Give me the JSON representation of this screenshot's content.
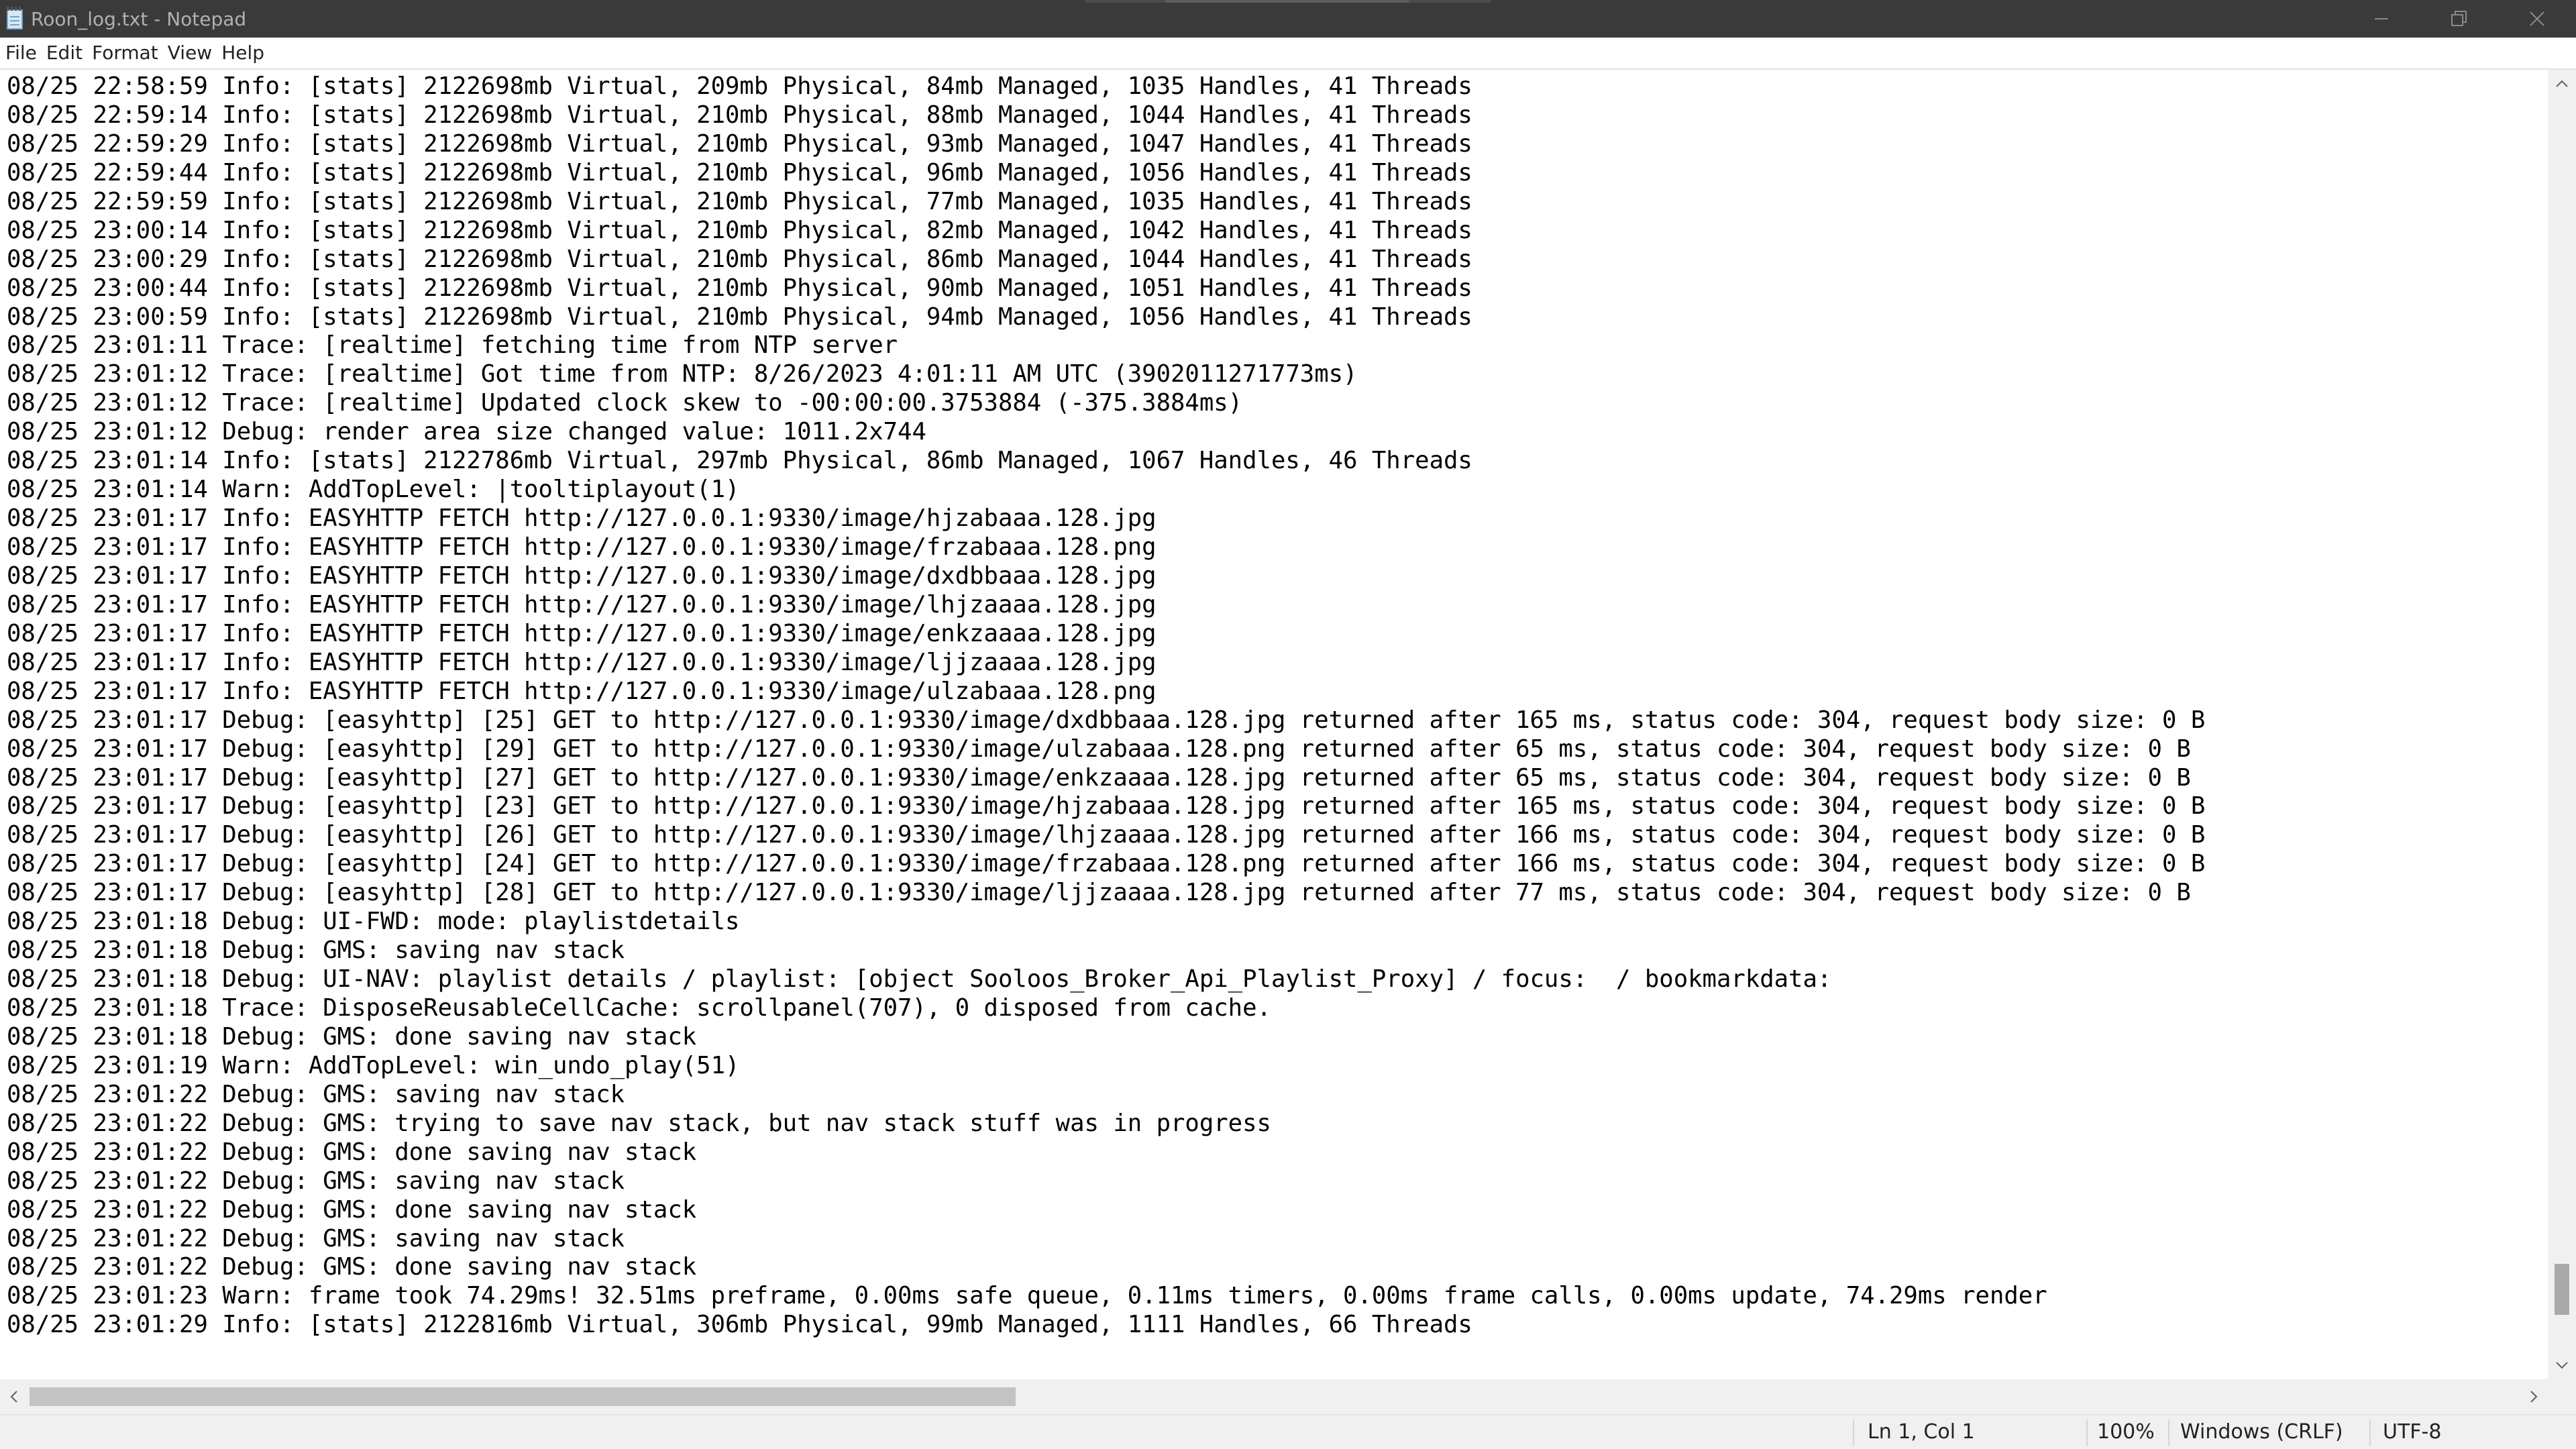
{
  "window": {
    "title": "Roon_log.txt - Notepad"
  },
  "menu": {
    "items": [
      "File",
      "Edit",
      "Format",
      "View",
      "Help"
    ]
  },
  "editor": {
    "lines": [
      "08/25 22:58:59 Info: [stats] 2122698mb Virtual, 209mb Physical, 84mb Managed, 1035 Handles, 41 Threads",
      "08/25 22:59:14 Info: [stats] 2122698mb Virtual, 210mb Physical, 88mb Managed, 1044 Handles, 41 Threads",
      "08/25 22:59:29 Info: [stats] 2122698mb Virtual, 210mb Physical, 93mb Managed, 1047 Handles, 41 Threads",
      "08/25 22:59:44 Info: [stats] 2122698mb Virtual, 210mb Physical, 96mb Managed, 1056 Handles, 41 Threads",
      "08/25 22:59:59 Info: [stats] 2122698mb Virtual, 210mb Physical, 77mb Managed, 1035 Handles, 41 Threads",
      "08/25 23:00:14 Info: [stats] 2122698mb Virtual, 210mb Physical, 82mb Managed, 1042 Handles, 41 Threads",
      "08/25 23:00:29 Info: [stats] 2122698mb Virtual, 210mb Physical, 86mb Managed, 1044 Handles, 41 Threads",
      "08/25 23:00:44 Info: [stats] 2122698mb Virtual, 210mb Physical, 90mb Managed, 1051 Handles, 41 Threads",
      "08/25 23:00:59 Info: [stats] 2122698mb Virtual, 210mb Physical, 94mb Managed, 1056 Handles, 41 Threads",
      "08/25 23:01:11 Trace: [realtime] fetching time from NTP server",
      "08/25 23:01:12 Trace: [realtime] Got time from NTP: 8/26/2023 4:01:11 AM UTC (3902011271773ms)",
      "08/25 23:01:12 Trace: [realtime] Updated clock skew to -00:00:00.3753884 (-375.3884ms)",
      "08/25 23:01:12 Debug: render area size changed value: 1011.2x744",
      "08/25 23:01:14 Info: [stats] 2122786mb Virtual, 297mb Physical, 86mb Managed, 1067 Handles, 46 Threads",
      "08/25 23:01:14 Warn: AddTopLevel: |tooltiplayout(1)",
      "08/25 23:01:17 Info: EASYHTTP FETCH http://127.0.0.1:9330/image/hjzabaaa.128.jpg",
      "08/25 23:01:17 Info: EASYHTTP FETCH http://127.0.0.1:9330/image/frzabaaa.128.png",
      "08/25 23:01:17 Info: EASYHTTP FETCH http://127.0.0.1:9330/image/dxdbbaaa.128.jpg",
      "08/25 23:01:17 Info: EASYHTTP FETCH http://127.0.0.1:9330/image/lhjzaaaa.128.jpg",
      "08/25 23:01:17 Info: EASYHTTP FETCH http://127.0.0.1:9330/image/enkzaaaa.128.jpg",
      "08/25 23:01:17 Info: EASYHTTP FETCH http://127.0.0.1:9330/image/ljjzaaaa.128.jpg",
      "08/25 23:01:17 Info: EASYHTTP FETCH http://127.0.0.1:9330/image/ulzabaaa.128.png",
      "08/25 23:01:17 Debug: [easyhttp] [25] GET to http://127.0.0.1:9330/image/dxdbbaaa.128.jpg returned after 165 ms, status code: 304, request body size: 0 B",
      "08/25 23:01:17 Debug: [easyhttp] [29] GET to http://127.0.0.1:9330/image/ulzabaaa.128.png returned after 65 ms, status code: 304, request body size: 0 B",
      "08/25 23:01:17 Debug: [easyhttp] [27] GET to http://127.0.0.1:9330/image/enkzaaaa.128.jpg returned after 65 ms, status code: 304, request body size: 0 B",
      "08/25 23:01:17 Debug: [easyhttp] [23] GET to http://127.0.0.1:9330/image/hjzabaaa.128.jpg returned after 165 ms, status code: 304, request body size: 0 B",
      "08/25 23:01:17 Debug: [easyhttp] [26] GET to http://127.0.0.1:9330/image/lhjzaaaa.128.jpg returned after 166 ms, status code: 304, request body size: 0 B",
      "08/25 23:01:17 Debug: [easyhttp] [24] GET to http://127.0.0.1:9330/image/frzabaaa.128.png returned after 166 ms, status code: 304, request body size: 0 B",
      "08/25 23:01:17 Debug: [easyhttp] [28] GET to http://127.0.0.1:9330/image/ljjzaaaa.128.jpg returned after 77 ms, status code: 304, request body size: 0 B",
      "08/25 23:01:18 Debug: UI-FWD: mode: playlistdetails",
      "08/25 23:01:18 Debug: GMS: saving nav stack",
      "08/25 23:01:18 Debug: UI-NAV: playlist details / playlist: [object Sooloos_Broker_Api_Playlist_Proxy] / focus:  / bookmarkdata:",
      "08/25 23:01:18 Trace: DisposeReusableCellCache: scrollpanel(707), 0 disposed from cache.",
      "08/25 23:01:18 Debug: GMS: done saving nav stack",
      "08/25 23:01:19 Warn: AddTopLevel: win_undo_play(51)",
      "08/25 23:01:22 Debug: GMS: saving nav stack",
      "08/25 23:01:22 Debug: GMS: trying to save nav stack, but nav stack stuff was in progress",
      "08/25 23:01:22 Debug: GMS: done saving nav stack",
      "08/25 23:01:22 Debug: GMS: saving nav stack",
      "08/25 23:01:22 Debug: GMS: done saving nav stack",
      "08/25 23:01:22 Debug: GMS: saving nav stack",
      "08/25 23:01:22 Debug: GMS: done saving nav stack",
      "08/25 23:01:23 Warn: frame took 74.29ms! 32.51ms preframe, 0.00ms safe queue, 0.11ms timers, 0.00ms frame calls, 0.00ms update, 74.29ms render",
      "08/25 23:01:29 Info: [stats] 2122816mb Virtual, 306mb Physical, 99mb Managed, 1111 Handles, 66 Threads"
    ]
  },
  "scroll": {
    "vertical_position": 0.97,
    "horizontal_position": 0.0
  },
  "statusbar": {
    "position": "Ln 1, Col 1",
    "zoom": "100%",
    "line_ending": "Windows (CRLF)",
    "encoding": "UTF-8"
  },
  "colors": {
    "titlebar_bg": "#3a3a3a",
    "editor_bg": "#ffffff",
    "statusbar_bg": "#f0f0f0"
  }
}
